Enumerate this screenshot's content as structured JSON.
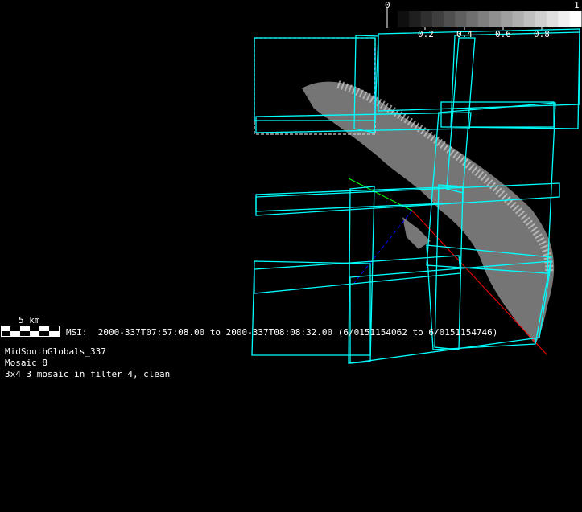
{
  "colorbar": {
    "min_label": "0",
    "max_label": "1",
    "tick_labels": [
      "0.2",
      "0.4",
      "0.6",
      "0.8"
    ],
    "steps": 16
  },
  "scale_bar": {
    "label": "5 km"
  },
  "msi_line": "MSI:  2000-337T07:57:08.00 to 2000-337T08:08:32.00 (6/0151154062 to 6/0151154746)",
  "info": {
    "name": "MidSouthGlobals_337",
    "mosaic": "Mosaic 8",
    "description": "3x4_3 mosaic in filter 4, clean"
  },
  "colors": {
    "frame": "#00ffff",
    "background": "#000000"
  }
}
